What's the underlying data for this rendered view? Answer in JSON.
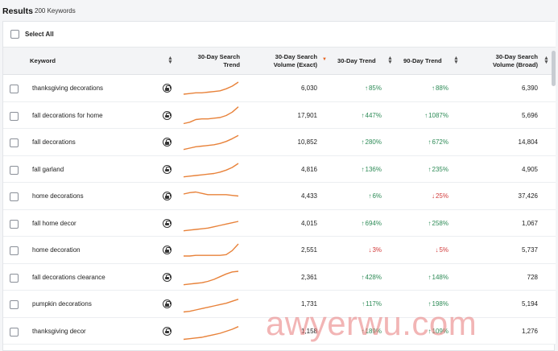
{
  "header": {
    "title": "Results",
    "count_label": "200 Keywords"
  },
  "select_all": {
    "label": "Select All"
  },
  "columns": {
    "keyword": "Keyword",
    "trend_line1": "30-Day Search",
    "trend_line2": "Trend",
    "volume_exact_line1": "30-Day Search",
    "volume_exact_line2": "Volume (Exact)",
    "trend30": "30-Day Trend",
    "trend90": "90-Day Trend",
    "volume_broad_line1": "30-Day Search",
    "volume_broad_line2": "Volume (Broad)"
  },
  "colors": {
    "sparkline": "#e8823a",
    "up": "#2e8b57",
    "down": "#d23b3b",
    "sort_active": "#e6621f"
  },
  "icons": {
    "lock": "lock-icon",
    "sort": "sort-icon",
    "up_arrow": "arrow-up-icon",
    "down_arrow": "arrow-down-icon"
  },
  "rows": [
    {
      "keyword": "thanksgiving decorations",
      "volume_exact": "6,030",
      "trend30": "85%",
      "trend30_dir": "up",
      "trend90": "88%",
      "trend90_dir": "up",
      "volume_broad": "6,390",
      "spark": [
        6,
        7,
        8,
        8,
        9,
        10,
        11,
        14,
        18,
        24
      ]
    },
    {
      "keyword": "fall decorations for home",
      "volume_exact": "17,901",
      "trend30": "447%",
      "trend30_dir": "up",
      "trend90": "1087%",
      "trend90_dir": "up",
      "volume_broad": "5,696",
      "spark": [
        3,
        5,
        9,
        10,
        10,
        11,
        12,
        15,
        20,
        28
      ]
    },
    {
      "keyword": "fall decorations",
      "volume_exact": "10,852",
      "trend30": "280%",
      "trend30_dir": "up",
      "trend90": "672%",
      "trend90_dir": "up",
      "volume_broad": "14,804",
      "spark": [
        4,
        6,
        8,
        9,
        10,
        11,
        13,
        16,
        20,
        25
      ]
    },
    {
      "keyword": "fall garland",
      "volume_exact": "4,816",
      "trend30": "136%",
      "trend30_dir": "up",
      "trend90": "235%",
      "trend90_dir": "up",
      "volume_broad": "4,905",
      "spark": [
        4,
        5,
        6,
        7,
        8,
        9,
        11,
        14,
        18,
        24
      ]
    },
    {
      "keyword": "home decorations",
      "volume_exact": "4,433",
      "trend30": "6%",
      "trend30_dir": "up",
      "trend90": "25%",
      "trend90_dir": "down",
      "volume_broad": "37,426",
      "spark": [
        18,
        20,
        21,
        19,
        17,
        17,
        17,
        17,
        16,
        15
      ]
    },
    {
      "keyword": "fall home decor",
      "volume_exact": "4,015",
      "trend30": "694%",
      "trend30_dir": "up",
      "trend90": "258%",
      "trend90_dir": "up",
      "volume_broad": "1,067",
      "spark": [
        4,
        5,
        6,
        7,
        8,
        10,
        12,
        14,
        16,
        18
      ]
    },
    {
      "keyword": "home decoration",
      "volume_exact": "2,551",
      "trend30": "3%",
      "trend30_dir": "down",
      "trend90": "5%",
      "trend90_dir": "down",
      "volume_broad": "5,737",
      "spark": [
        6,
        6,
        7,
        7,
        7,
        7,
        7,
        8,
        14,
        24
      ]
    },
    {
      "keyword": "fall decorations clearance",
      "volume_exact": "2,361",
      "trend30": "428%",
      "trend30_dir": "up",
      "trend90": "148%",
      "trend90_dir": "up",
      "volume_broad": "728",
      "spark": [
        4,
        5,
        6,
        7,
        9,
        12,
        16,
        20,
        23,
        24
      ]
    },
    {
      "keyword": "pumpkin decorations",
      "volume_exact": "1,731",
      "trend30": "117%",
      "trend30_dir": "up",
      "trend90": "198%",
      "trend90_dir": "up",
      "volume_broad": "5,194",
      "spark": [
        3,
        4,
        6,
        8,
        10,
        12,
        14,
        16,
        19,
        22
      ]
    },
    {
      "keyword": "thanksgiving decor",
      "volume_exact": "1,158",
      "trend30": "189%",
      "trend30_dir": "up",
      "trend90": "109%",
      "trend90_dir": "up",
      "volume_broad": "1,276",
      "spark": [
        3,
        4,
        5,
        6,
        8,
        10,
        12,
        15,
        18,
        22
      ]
    }
  ],
  "watermark": "awyerwu.com"
}
